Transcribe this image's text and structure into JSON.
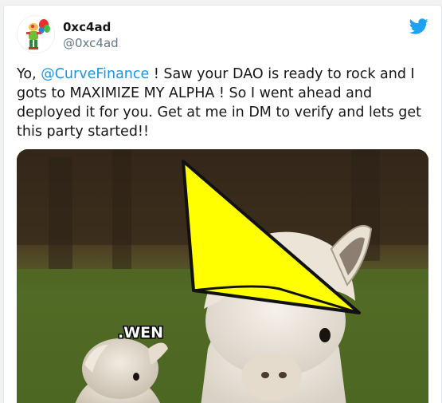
{
  "tweet": {
    "display_name": "0xc4ad",
    "handle": "@0xc4ad",
    "text_before": "Yo, ",
    "mention": "@CurveFinance",
    "text_after": " ! Saw your DAO is ready to rock and I gots to MAXIMIZE MY ALPHA ! So I went ahead and deployed it for you. Get at me in DM to verify and lets get this party started!!"
  },
  "media": {
    "overlay_label": ".WEN"
  },
  "icons": {
    "brand": "twitter-bird-icon",
    "avatar": "avatar-image"
  },
  "colors": {
    "link": "#1b95e0",
    "brand": "#1da1f2",
    "text": "#14171a",
    "muted": "#657786",
    "hat": "#ffff00"
  }
}
